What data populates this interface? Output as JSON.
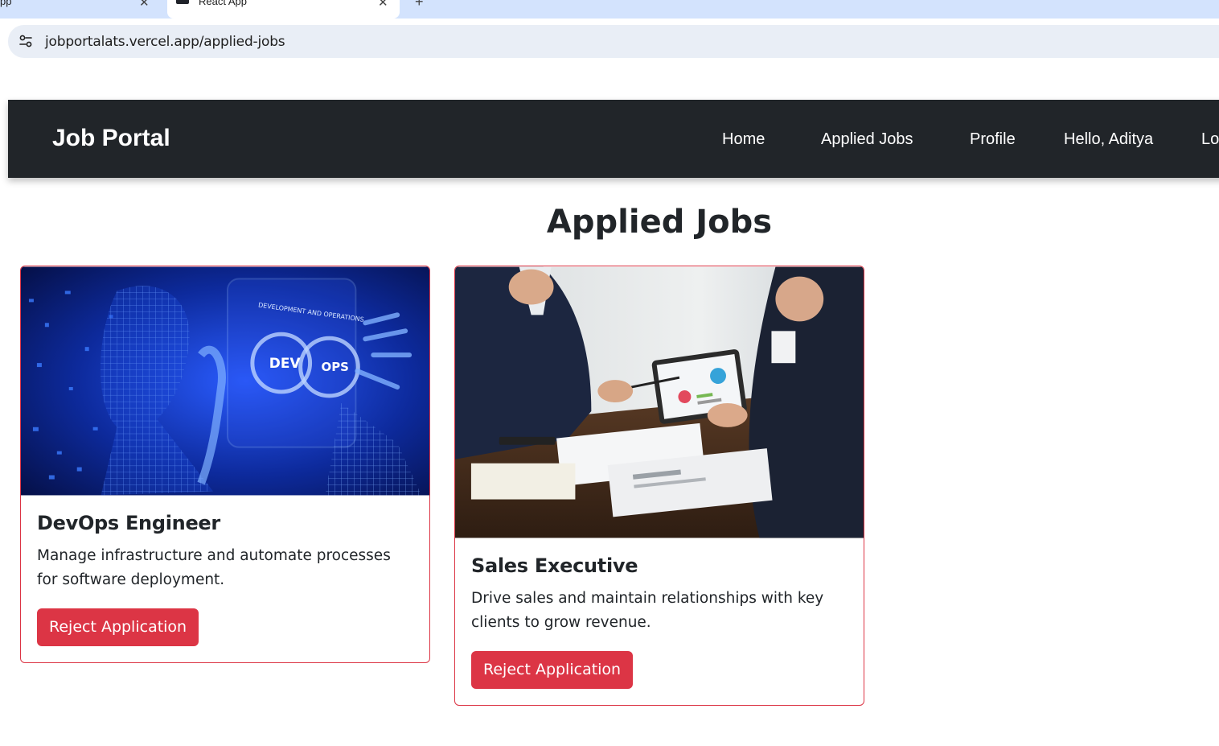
{
  "browser": {
    "tabs": [
      {
        "label": "pp",
        "close": "✕"
      },
      {
        "label": "React App",
        "close": "✕"
      }
    ],
    "new_tab": "+",
    "url": "jobportalats.vercel.app/applied-jobs"
  },
  "navbar": {
    "brand": "Job Portal",
    "links": [
      "Home",
      "Applied Jobs",
      "Profile",
      "Hello, Aditya",
      "Lo"
    ]
  },
  "page": {
    "title": "Applied Jobs"
  },
  "jobs": [
    {
      "title": "DevOps Engineer",
      "description": "Manage infrastructure and automate processes for software deployment.",
      "button": "Reject Application",
      "image_text": {
        "banner": "DEVELOPMENT AND OPERATIONS",
        "left": "DEV",
        "right": "OPS"
      }
    },
    {
      "title": "Sales Executive",
      "description": "Drive sales and maintain relationships with key clients to grow revenue.",
      "button": "Reject Application"
    }
  ],
  "colors": {
    "navbar": "#212529",
    "danger": "#dc3545",
    "tabstrip": "#d3e3fd",
    "omnibox": "#e9eef6"
  }
}
